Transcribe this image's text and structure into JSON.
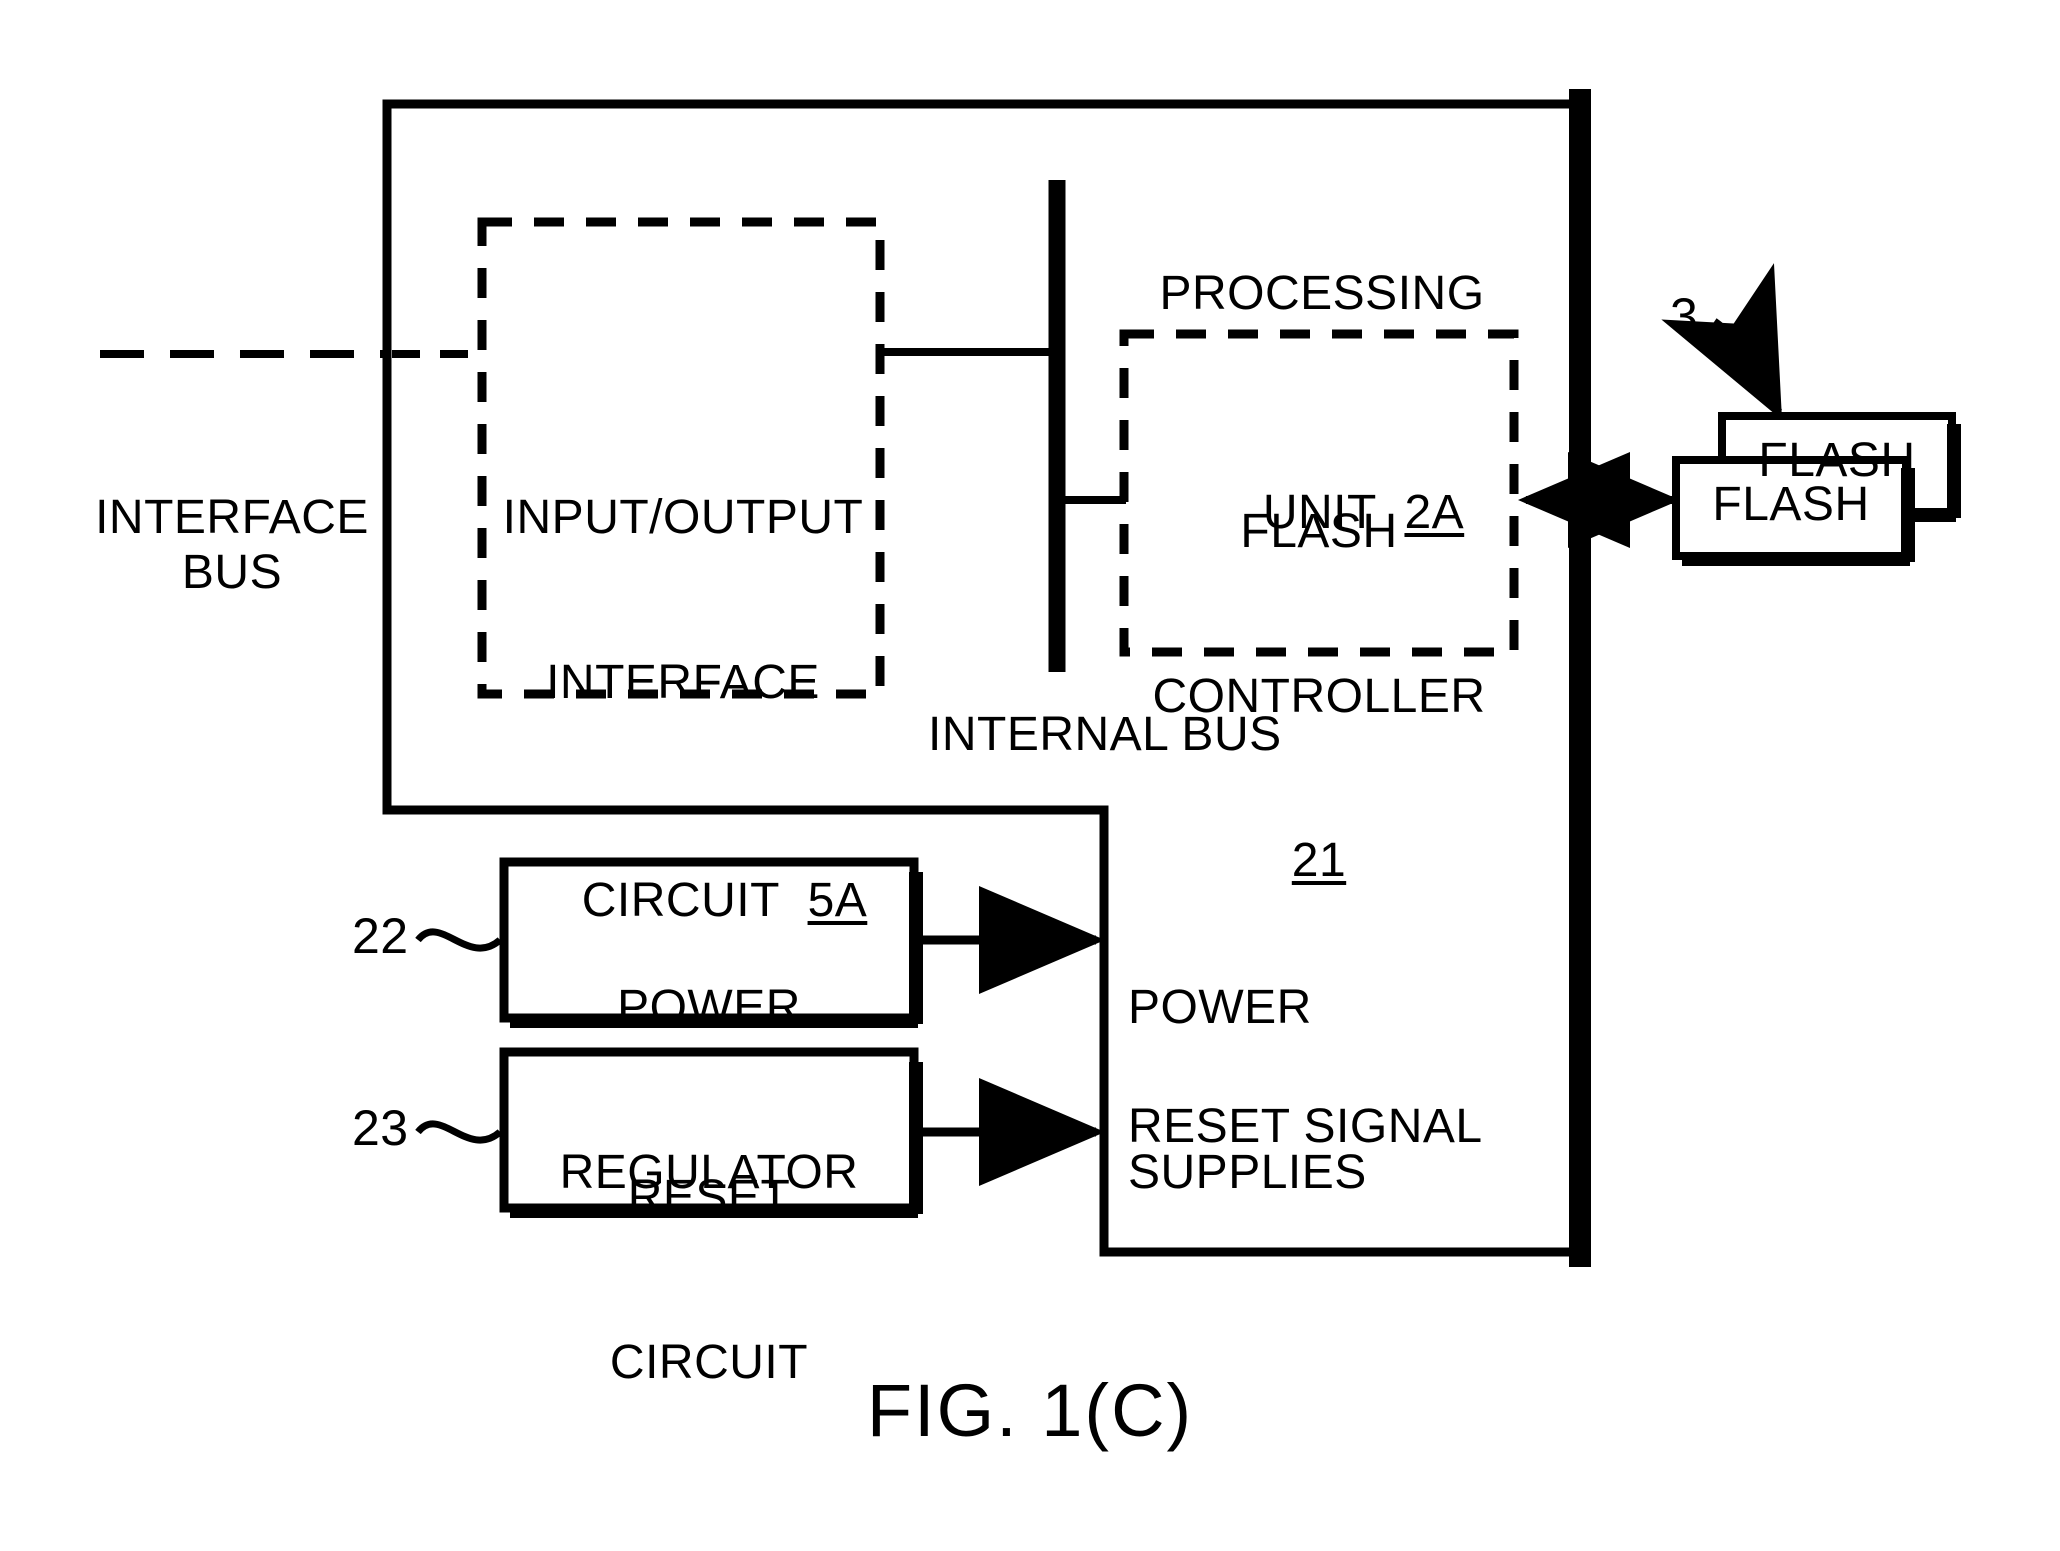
{
  "figure": {
    "caption": "FIG. 1(C)"
  },
  "labels": {
    "interface_bus": "INTERFACE\nBUS",
    "internal_bus": "INTERNAL BUS",
    "processing_unit_line1": "PROCESSING",
    "processing_unit_line2": "UNIT",
    "processing_unit_ref": "2A",
    "io_interface_line1": "INPUT/OUTPUT",
    "io_interface_line2": "INTERFACE",
    "io_interface_line3": "CIRCUIT",
    "io_interface_ref": "5A",
    "flash_controller_line1": "FLASH",
    "flash_controller_line2": "CONTROLLER",
    "flash_controller_ref": "21",
    "flash_memory_back": "FLASH",
    "flash_memory_front": "FLASH",
    "flash_memory_ref": "3",
    "power_regulator_line1": "POWER",
    "power_regulator_line2": "REGULATOR",
    "power_regulator_ref": "22",
    "reset_circuit_line1": "RESET",
    "reset_circuit_line2": "CIRCUIT",
    "reset_circuit_ref": "23",
    "power_supplies_line1": "POWER",
    "power_supplies_line2": "SUPPLIES",
    "reset_signal": "RESET SIGNAL"
  },
  "style": {
    "ink": "#000000",
    "paper": "#ffffff"
  }
}
